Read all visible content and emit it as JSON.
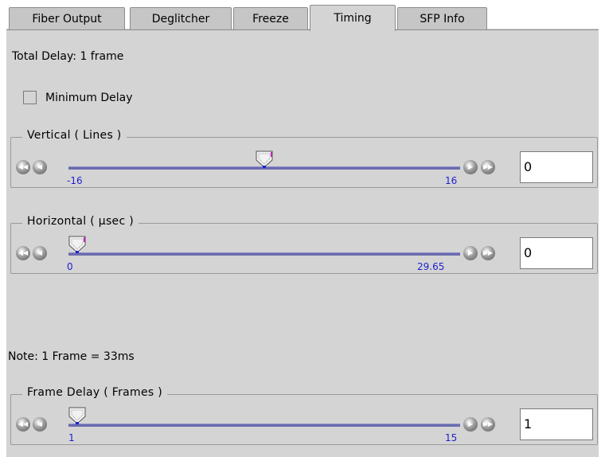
{
  "tabs": [
    {
      "label": "Fiber Output",
      "active": false
    },
    {
      "label": "Deglitcher",
      "active": false
    },
    {
      "label": "Freeze",
      "active": false
    },
    {
      "label": "Timing",
      "active": true
    },
    {
      "label": "SFP Info",
      "active": false
    }
  ],
  "total_delay": "Total Delay: 1 frame",
  "minimum_delay": {
    "label": "Minimum Delay",
    "checked": false
  },
  "vertical": {
    "title": "Vertical ( Lines )",
    "min_label": "-16",
    "max_label": "16",
    "value": "0",
    "min": -16,
    "max": 16,
    "current": 0
  },
  "horizontal": {
    "title": "Horizontal ( µsec )",
    "min_label": "0",
    "max_label": "29.65",
    "value": "0",
    "min": 0,
    "max": 29.65,
    "current": 0
  },
  "note": "Note: 1 Frame = 33ms",
  "frame_delay": {
    "title": "Frame Delay ( Frames )",
    "min_label": "1",
    "max_label": "15",
    "value": "1",
    "min": 1,
    "max": 15,
    "current": 1
  },
  "colors": {
    "track": "#6b6bb0",
    "tick_text": "#1f1fd0",
    "panel": "#d4d4d4"
  }
}
